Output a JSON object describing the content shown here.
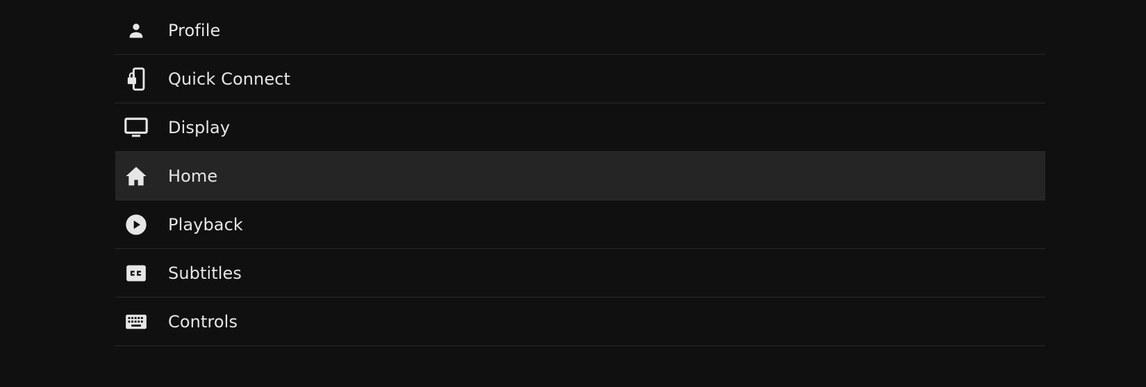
{
  "menu": {
    "items": [
      {
        "label": "Profile",
        "icon": "person-icon",
        "active": false
      },
      {
        "label": "Quick Connect",
        "icon": "phonelink-lock-icon",
        "active": false
      },
      {
        "label": "Display",
        "icon": "monitor-icon",
        "active": false
      },
      {
        "label": "Home",
        "icon": "home-icon",
        "active": true
      },
      {
        "label": "Playback",
        "icon": "play-circle-icon",
        "active": false
      },
      {
        "label": "Subtitles",
        "icon": "closed-caption-icon",
        "active": false
      },
      {
        "label": "Controls",
        "icon": "keyboard-icon",
        "active": false
      }
    ]
  },
  "colors": {
    "background": "#101010",
    "active_row": "#252525",
    "divider": "#2a2a2a",
    "text": "#e6e6e6",
    "icon": "#e6e6e6"
  }
}
